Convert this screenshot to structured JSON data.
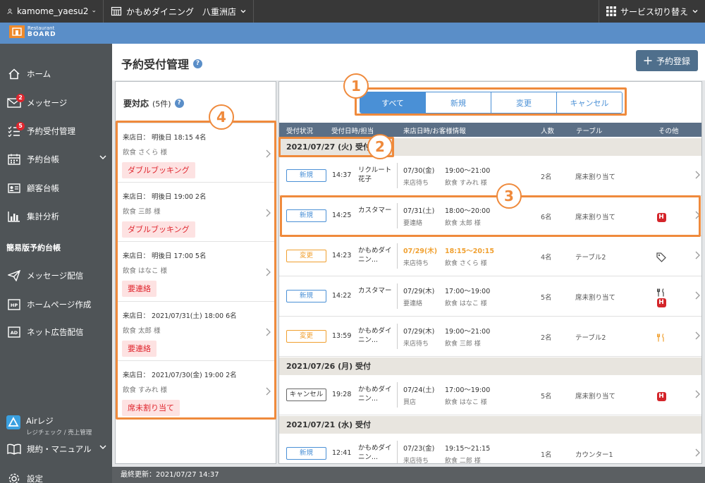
{
  "topbar": {
    "user": "kamome_yaesu2",
    "store": "かもめダイニング　八重洲店",
    "service_switch": "サービス切り替え"
  },
  "brand": {
    "small": "Restaurant",
    "big": "BOARD"
  },
  "sidebar": {
    "items": [
      {
        "label": "ホーム"
      },
      {
        "label": "メッセージ",
        "badge": "2"
      },
      {
        "label": "予約受付管理",
        "badge": "5"
      },
      {
        "label": "予約台帳"
      },
      {
        "label": "顧客台帳"
      },
      {
        "label": "集計分析"
      }
    ],
    "section": "簡易版予約台帳",
    "items2": [
      {
        "label": "メッセージ配信"
      },
      {
        "label": "ホームページ作成"
      },
      {
        "label": "ネット広告配信"
      }
    ],
    "airregi": {
      "title": "Airレジ",
      "subtitle": "レジチェック / 売上管理"
    },
    "items3": [
      {
        "label": "規約・マニュアル"
      },
      {
        "label": "設定"
      }
    ]
  },
  "header": {
    "title": "予約受付管理",
    "register_label": "予約登録"
  },
  "left_panel": {
    "title": "要対応",
    "count": "(5件)",
    "cards": [
      {
        "line1": "来店日： 明後日 18:15  4名",
        "line2": "飲食 さくら 様",
        "tag": "ダブルブッキング"
      },
      {
        "line1": "来店日： 明後日 19:00  2名",
        "line2": "飲食 三郎 様",
        "tag": "ダブルブッキング"
      },
      {
        "line1": "来店日： 明後日 17:00  5名",
        "line2": "飲食 はなこ 様",
        "tag": "要連絡"
      },
      {
        "line1": "来店日： 2021/07/31(土) 18:00  6名",
        "line2": "飲食 太郎 様",
        "tag": "要連絡"
      },
      {
        "line1": "来店日： 2021/07/30(金) 19:00  2名",
        "line2": "飲食 すみれ 様",
        "tag": "席未割り当て"
      }
    ]
  },
  "filter_tabs": [
    "すべて",
    "新規",
    "変更",
    "キャンセル"
  ],
  "columns": [
    "受付状況",
    "受付日時/担当",
    "来店日時/お客様情報",
    "人数",
    "テーブル",
    "その他"
  ],
  "groups": [
    {
      "date": "2021/07/27 (火) 受付"
    },
    {
      "date": "2021/07/26 (月) 受付"
    },
    {
      "date": "2021/07/21 (水) 受付"
    }
  ],
  "rows": [
    {
      "status": "新規",
      "time": "14:37",
      "staff": "リクルート花子",
      "date": "07/30(金)",
      "sub": "来店待ち",
      "visit_time": "19:00〜21:00",
      "customer": "飲食 すみれ 様",
      "people": "2名",
      "table": "席未割り当て"
    },
    {
      "status": "新規",
      "time": "14:25",
      "staff": "カスタマー",
      "date": "07/31(土)",
      "sub": "要連絡",
      "visit_time": "18:00〜20:00",
      "customer": "飲食 太郎 様",
      "people": "6名",
      "table": "席未割り当て"
    },
    {
      "status": "変更",
      "time": "14:23",
      "staff": "かもめダイニン...",
      "date": "07/29(木)",
      "sub": "来店待ち",
      "visit_time": "18:15〜20:15",
      "customer": "飲食 さくら 様",
      "people": "4名",
      "table": "テーブル2"
    },
    {
      "status": "新規",
      "time": "14:22",
      "staff": "カスタマー",
      "date": "07/29(木)",
      "sub": "要連絡",
      "visit_time": "17:00〜19:00",
      "customer": "飲食 はなこ 様",
      "people": "5名",
      "table": "席未割り当て"
    },
    {
      "status": "変更",
      "time": "13:59",
      "staff": "かもめダイニン...",
      "date": "07/29(木)",
      "sub": "来店待ち",
      "visit_time": "19:00〜21:00",
      "customer": "飲食 三郎 様",
      "people": "2名",
      "table": "テーブル2"
    },
    {
      "status": "キャンセル",
      "time": "19:28",
      "staff": "かもめダイニン...",
      "date": "07/24(土)",
      "sub": "買店",
      "visit_time": "17:00〜19:00",
      "customer": "飲食 はなこ 様",
      "people": "5名",
      "table": "席未割り当て"
    },
    {
      "status": "新規",
      "time": "12:41",
      "staff": "かもめダイニン...",
      "date": "07/23(金)",
      "sub": "来店待ち",
      "visit_time": "19:15〜21:15",
      "customer": "飲食 二郎 様",
      "people": "1名",
      "table": "カウンター1"
    }
  ],
  "callouts": [
    "1",
    "2",
    "3",
    "4"
  ],
  "footer": {
    "updated": "最終更新：2021/07/27 14:37"
  },
  "icon_letter": "H",
  "colors": {
    "accent": "#4a90d6",
    "callout": "#ef8a3c",
    "alert": "#e0262e",
    "changed": "#f0a030",
    "sidebar": "#4f5457",
    "brand": "#5a8ec8"
  }
}
